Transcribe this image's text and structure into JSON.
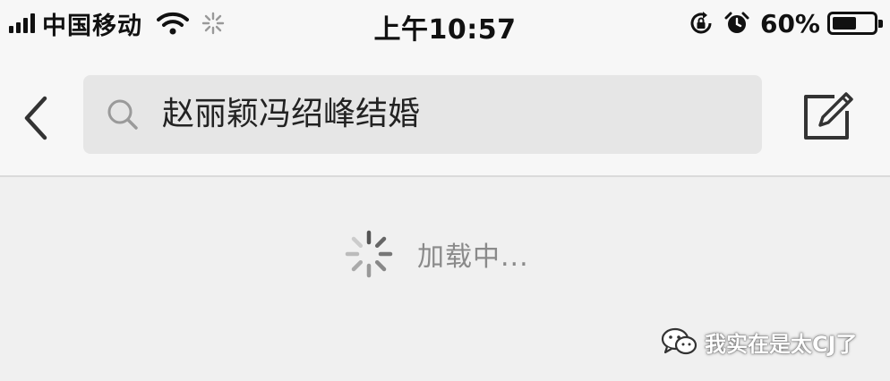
{
  "status_bar": {
    "carrier": "中国移动",
    "time": "上午10:57",
    "battery_percent": "60%",
    "battery_level": 0.6,
    "icons": [
      "signal-icon",
      "wifi-icon",
      "activity-icon",
      "rotation-lock-icon",
      "alarm-icon",
      "battery-icon"
    ]
  },
  "nav": {
    "back_icon": "chevron-left-icon",
    "search_query": "赵丽颖冯绍峰结婚",
    "search_icon": "search-icon",
    "compose_icon": "compose-icon"
  },
  "content": {
    "loading_text": "加载中..."
  },
  "watermark": {
    "icon": "wechat-icon",
    "text": "我实在是太CJ了"
  },
  "colors": {
    "background": "#f0f0f0",
    "bar_background": "#f7f7f7",
    "search_background": "#e6e6e6",
    "muted_text": "#8a8a8a"
  }
}
